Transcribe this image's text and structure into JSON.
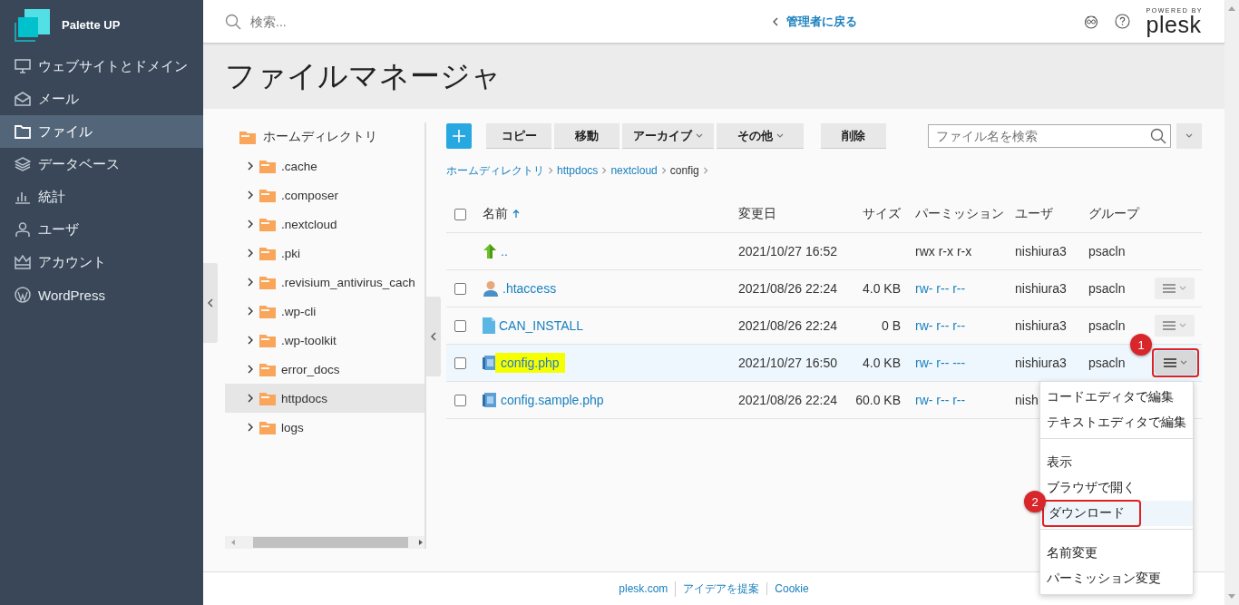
{
  "brand": {
    "name": "Palette UP"
  },
  "sidebar": {
    "items": [
      {
        "label": "ウェブサイトとドメイン",
        "selected": false
      },
      {
        "label": "メール",
        "selected": false
      },
      {
        "label": "ファイル",
        "selected": true
      },
      {
        "label": "データベース",
        "selected": false
      },
      {
        "label": "統計",
        "selected": false
      },
      {
        "label": "ユーザ",
        "selected": false
      },
      {
        "label": "アカウント",
        "selected": false
      },
      {
        "label": "WordPress",
        "selected": false
      }
    ]
  },
  "topbar": {
    "search": {
      "placeholder": "検索..."
    },
    "back_link": "管理者に戻る",
    "powered_by": "POWERED BY",
    "logo": "plesk"
  },
  "page_title": "ファイルマネージャ",
  "tree": {
    "label": "ホームディレクトリ",
    "children": [
      {
        "label": ".cache",
        "selected": false
      },
      {
        "label": ".composer",
        "selected": false
      },
      {
        "label": ".nextcloud",
        "selected": false
      },
      {
        "label": ".pki",
        "selected": false
      },
      {
        "label": ".revisium_antivirus_cach",
        "selected": false
      },
      {
        "label": ".wp-cli",
        "selected": false
      },
      {
        "label": ".wp-toolkit",
        "selected": false
      },
      {
        "label": "error_docs",
        "selected": false
      },
      {
        "label": "httpdocs",
        "selected": true
      },
      {
        "label": "logs",
        "selected": false
      }
    ]
  },
  "toolbar": {
    "buttons": [
      {
        "label": "コピー",
        "dropdown": false
      },
      {
        "label": "移動",
        "dropdown": false
      },
      {
        "label": "アーカイブ",
        "dropdown": true
      },
      {
        "label": "その他",
        "dropdown": true
      },
      {
        "label": "削除",
        "dropdown": false
      }
    ],
    "search": {
      "placeholder": "ファイル名を検索"
    }
  },
  "breadcrumb": [
    {
      "label": "ホームディレクトリ",
      "link": true
    },
    {
      "label": "httpdocs",
      "link": true
    },
    {
      "label": "nextcloud",
      "link": true
    },
    {
      "label": "config",
      "link": false
    }
  ],
  "table": {
    "columns": [
      {
        "label": "名前",
        "sorted": true
      },
      {
        "label": "変更日",
        "sorted": false
      },
      {
        "label": "サイズ",
        "sorted": false
      },
      {
        "label": "パーミッション",
        "sorted": false
      },
      {
        "label": "ユーザ",
        "sorted": false
      },
      {
        "label": "グループ",
        "sorted": false
      }
    ],
    "select_all": {
      "checked": false
    },
    "rows": [
      {
        "kind": "parent",
        "name": "..",
        "modified": "2021/10/27 16:52",
        "permissions": "rwx r-x r-x",
        "user": "nishiura3",
        "group": "psacln"
      },
      {
        "kind": "file",
        "name": ".htaccess",
        "modified": "2021/08/26 22:24",
        "size": "4.0 KB",
        "permissions": "rw- r-- r--",
        "user": "nishiura3",
        "group": "psacln",
        "checked": false,
        "selected": false,
        "highlighted": false,
        "menu_open": false
      },
      {
        "kind": "file",
        "name": "CAN_INSTALL",
        "modified": "2021/08/26 22:24",
        "size": "0 B",
        "permissions": "rw- r-- r--",
        "user": "nishiura3",
        "group": "psacln",
        "checked": false,
        "selected": false,
        "highlighted": false,
        "menu_open": false
      },
      {
        "kind": "file",
        "name": "config.php",
        "modified": "2021/10/27 16:50",
        "size": "4.0 KB",
        "permissions": "rw- r-- ---",
        "user": "nishiura3",
        "group": "psacln",
        "checked": false,
        "selected": true,
        "highlighted": true,
        "menu_open": true,
        "annotation": "1"
      },
      {
        "kind": "file",
        "name": "config.sample.php",
        "modified": "2021/08/26 22:24",
        "size": "60.0 KB",
        "permissions": "rw- r-- r--",
        "user": "nish",
        "checked": false,
        "selected": false,
        "highlighted": false
      }
    ]
  },
  "context_menu": {
    "groups": [
      [
        {
          "label": "コードエディタで編集",
          "selected": false
        },
        {
          "label": "テキストエディタで編集",
          "selected": false
        }
      ],
      [
        {
          "label": "表示",
          "selected": false
        },
        {
          "label": "ブラウザで開く",
          "selected": false
        },
        {
          "label": "ダウンロード",
          "selected": true,
          "annotation": "2"
        }
      ],
      [
        {
          "label": "名前変更",
          "selected": false
        },
        {
          "label": "パーミッション変更",
          "selected": false
        }
      ]
    ]
  },
  "footer": {
    "links": [
      "plesk.com",
      "アイデアを提案",
      "Cookie"
    ]
  }
}
